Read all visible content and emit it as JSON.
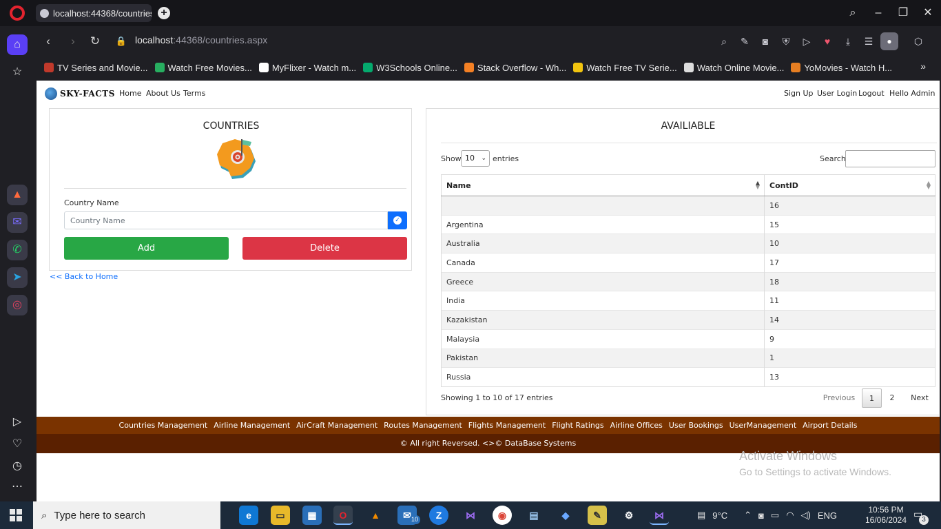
{
  "browser": {
    "tab_title": "localhost:44368/countries.",
    "url_host": "localhost",
    "url_rest": ":44368/countries.aspx",
    "bookmarks": [
      {
        "label": "TV Series and Movie...",
        "color": "#c0392b"
      },
      {
        "label": "Watch Free Movies...",
        "color": "#27ae60"
      },
      {
        "label": "MyFlixer - Watch m...",
        "color": "#ffffff"
      },
      {
        "label": "W3Schools Online...",
        "color": "#04aa6d"
      },
      {
        "label": "Stack Overflow - Wh...",
        "color": "#f48024"
      },
      {
        "label": "Watch Free TV Serie...",
        "color": "#f1c40f"
      },
      {
        "label": "Watch Online Movie...",
        "color": "#dddddd"
      },
      {
        "label": "YoMovies - Watch H...",
        "color": "#e67e22"
      }
    ]
  },
  "site": {
    "brand": "SKY-FACTS",
    "nav_left": [
      "Home",
      "About Us",
      "Terms"
    ],
    "nav_right": [
      "Sign Up",
      "User Login",
      "Logout",
      "Hello Admin"
    ]
  },
  "form": {
    "title": "COUNTRIES",
    "field_label": "Country Name",
    "field_placeholder": "Country Name",
    "add_label": "Add",
    "delete_label": "Delete",
    "back_link": "<< Back to Home"
  },
  "table_panel": {
    "title": "AVAILIABLE",
    "show_label": "Show",
    "page_size": "10",
    "entries_label": "entries",
    "search_label": "Search:",
    "columns": [
      "Name",
      "ContID"
    ],
    "rows": [
      {
        "name": "",
        "id": "16"
      },
      {
        "name": "Argentina",
        "id": "15"
      },
      {
        "name": "Australia",
        "id": "10"
      },
      {
        "name": "Canada",
        "id": "17"
      },
      {
        "name": "Greece",
        "id": "18"
      },
      {
        "name": "India",
        "id": "11"
      },
      {
        "name": "Kazakistan",
        "id": "14"
      },
      {
        "name": "Malaysia",
        "id": "9"
      },
      {
        "name": "Pakistan",
        "id": "1"
      },
      {
        "name": "Russia",
        "id": "13"
      }
    ],
    "info": "Showing 1 to 10 of 17 entries",
    "pagination": {
      "previous": "Previous",
      "pages": [
        "1",
        "2"
      ],
      "next": "Next"
    }
  },
  "footer": {
    "links": [
      "Countries Management",
      "Airline Management",
      "AirCraft Management",
      "Routes Management",
      "Flights Management",
      "Flight Ratings",
      "Airline Offices",
      "User Bookings",
      "UserManagement",
      "Airport Details"
    ],
    "copyright": "© All right Reversed. <>© DataBase Systems"
  },
  "watermark": {
    "line1": "Activate Windows",
    "line2": "Go to Settings to activate Windows."
  },
  "taskbar": {
    "search_placeholder": "Type here to search",
    "weather": "9°C",
    "language": "ENG",
    "time": "10:56 PM",
    "date": "16/06/2024",
    "notification_count": "3",
    "mail_badge": "10"
  },
  "colors": {
    "footer_nav": "#7a3300",
    "footer_copy": "#5a2000",
    "add": "#28a745",
    "delete": "#dc3545",
    "link": "#0d6efd"
  }
}
